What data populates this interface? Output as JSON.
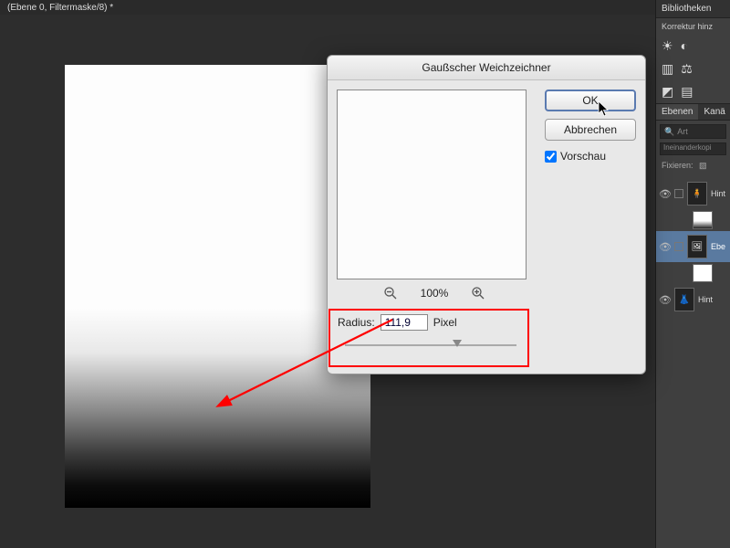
{
  "title": "(Ebene 0, Filtermaske/8) *",
  "right_panel": {
    "biblio": "Bibliotheken",
    "korrektur": "Korrektur hinz",
    "tabs": {
      "ebenen": "Ebenen",
      "kanal": "Kanä"
    },
    "search_placeholder": "Art",
    "dropdown": "Ineinanderkopi",
    "lock_label": "Fixieren:",
    "layers": [
      {
        "name": "Hint"
      },
      {
        "name": "Ebe"
      },
      {
        "name": "Hint"
      }
    ]
  },
  "dialog": {
    "title": "Gaußscher Weichzeichner",
    "ok": "OK",
    "cancel": "Abbrechen",
    "preview": "Vorschau",
    "preview_checked": true,
    "zoom_value": "100%",
    "radius_label": "Radius:",
    "radius_value": "111,9",
    "radius_unit": "Pixel"
  }
}
